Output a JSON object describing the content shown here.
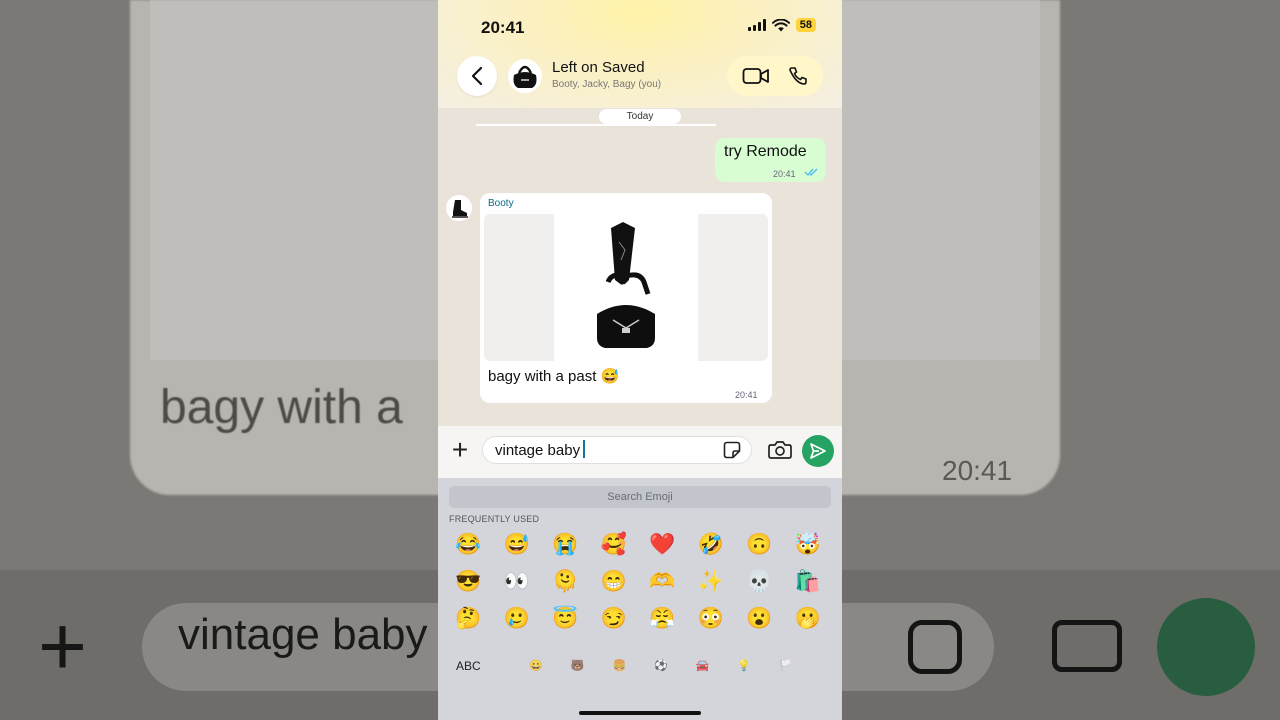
{
  "background": {
    "message_text": "bagy with a",
    "message_time": "20:41",
    "input_text": "vintage baby"
  },
  "status_bar": {
    "time": "20:41",
    "battery": "58"
  },
  "chat_header": {
    "title": "Left on Saved",
    "members": "Booty, Jacky, Bagy (you)"
  },
  "date_chip": "Today",
  "messages": [
    {
      "direction": "outgoing",
      "text": "try Remode",
      "time": "20:41",
      "status": "read"
    },
    {
      "direction": "incoming",
      "sender": "Booty",
      "caption": "bagy with a past 😅",
      "time": "20:41",
      "has_image": true
    }
  ],
  "compose": {
    "value": "vintage baby"
  },
  "emoji_keyboard": {
    "search_placeholder": "Search Emoji",
    "section_label": "FREQUENTLY USED",
    "emojis": [
      "😂",
      "😅",
      "😭",
      "🥰",
      "❤️",
      "🤣",
      "🙃",
      "🤯",
      "😎",
      "👀",
      "🫠",
      "😁",
      "🫶",
      "✨",
      "💀",
      "🛍️",
      "🤔",
      "🥲",
      "😇",
      "😏",
      "😤",
      "😳",
      "😮",
      "🫢"
    ],
    "abc_label": "ABC",
    "categories": [
      "😀",
      "🐻",
      "🍔",
      "⚽",
      "🚘",
      "💡",
      "🏳️"
    ]
  },
  "colors": {
    "send_button": "#25a363",
    "outgoing_bubble": "#d9fdd3",
    "sender_name": "#0a6a86"
  }
}
